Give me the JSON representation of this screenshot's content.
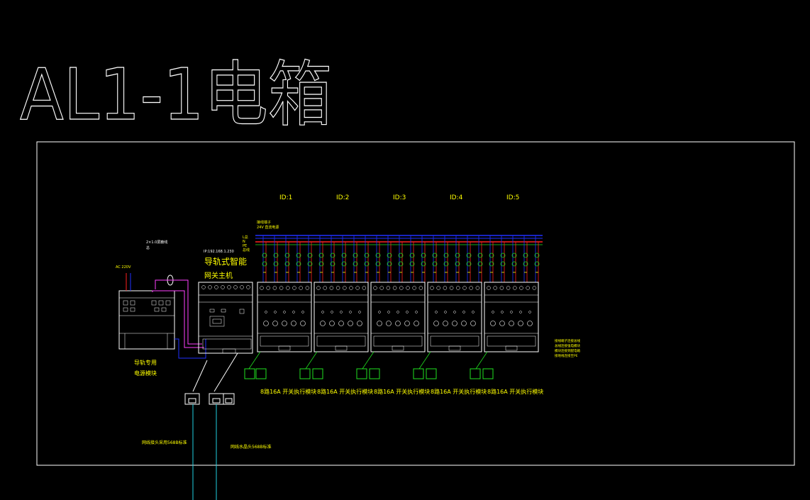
{
  "title": "AL1-1电箱",
  "module_ids": [
    "ID:1",
    "ID:2",
    "ID:3",
    "ID:4",
    "ID:5"
  ],
  "gateway": {
    "ip_label": "IP:192.168.1.230",
    "name_line1": "导轨式智能",
    "name_line2": "网关主机"
  },
  "power_supply": {
    "ac_label": "AC 220V",
    "cable_note": "2×1.0屏蔽线",
    "cable_note2": "总",
    "name_line1": "导轨专用",
    "name_line2": "电源模块"
  },
  "relay_module_label": "8路16A 开关执行模块",
  "bus_note_line1": "接线端子",
  "bus_note_line2": "24V 直流电源",
  "bus_side_note_line1": "L总",
  "bus_side_note_line2": "N",
  "bus_side_note_line3": "PE",
  "bus_side_note_line4": "总线",
  "right_note_lines": [
    "接线端子连接总线",
    "总线连接强电模块",
    "模块连接到配电箱",
    "接地线连接至PE"
  ],
  "wiring_notes": [
    "网线接头采用568B标准",
    "网线水晶头568B标准"
  ],
  "colors": {
    "frame": "#ffffff",
    "text_yellow": "#ffff00",
    "bus_blue": "#2030ff",
    "bus_red": "#ff2020",
    "magenta": "#ff40ff",
    "cyan": "#20d0e0",
    "green": "#20e020"
  }
}
